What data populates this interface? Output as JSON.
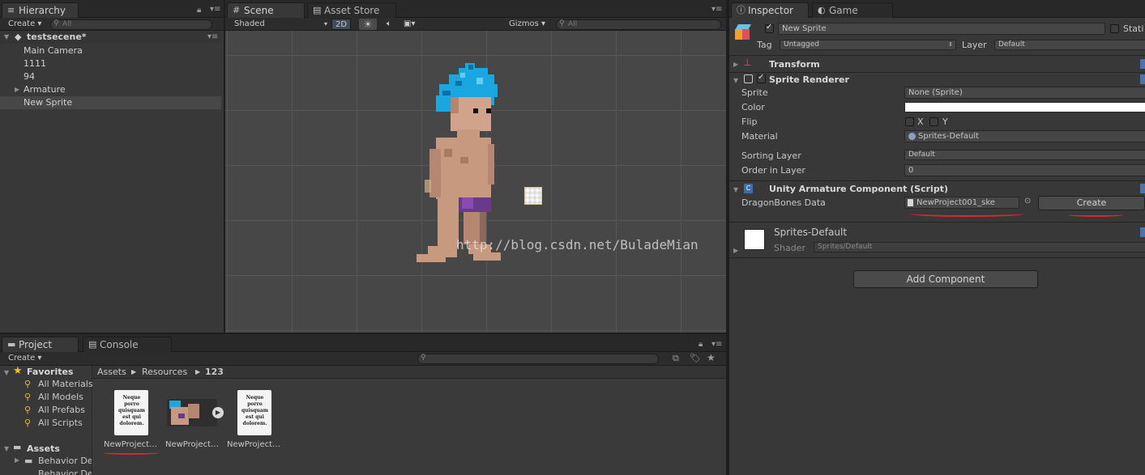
{
  "hierarchy": {
    "tab_label": "Hierarchy",
    "create_label": "Create ▾",
    "search_placeholder": "All",
    "scene_name": "testsecene*",
    "items": [
      "Main Camera",
      "1111",
      "94",
      "Armature",
      "New Sprite"
    ]
  },
  "scene": {
    "tab_scene": "Scene",
    "tab_asset_store": "Asset Store",
    "shading_mode": "Shaded",
    "mode_2d": "2D",
    "gizmos_label": "Gizmos ▾",
    "search_placeholder": "All",
    "watermark": "http://blog.csdn.net/BuladeMian"
  },
  "project": {
    "tab_project": "Project",
    "tab_console": "Console",
    "create_label": "Create ▾",
    "favorites_label": "Favorites",
    "favorites": [
      "All Materials",
      "All Models",
      "All Prefabs",
      "All Scripts"
    ],
    "assets_label": "Assets",
    "assets_children": [
      "Behavior De",
      "Behavior De"
    ],
    "breadcrumb": [
      "Assets",
      "Resources",
      "123"
    ],
    "files": [
      {
        "name": "NewProject…",
        "thumb_text": "Neque porro quisquam est qui dolorem."
      },
      {
        "name": "NewProject…",
        "thumb_text": ""
      },
      {
        "name": "NewProject…",
        "thumb_text": "Neque porro quisquam est qui dolorem."
      }
    ]
  },
  "inspector": {
    "tab_inspector": "Inspector",
    "tab_game": "Game",
    "object_name": "New Sprite",
    "static_label": "Stati",
    "tag_label": "Tag",
    "tag_value": "Untagged",
    "layer_label": "Layer",
    "layer_value": "Default",
    "transform_title": "Transform",
    "sprite_renderer": {
      "title": "Sprite Renderer",
      "sprite_label": "Sprite",
      "sprite_value": "None (Sprite)",
      "color_label": "Color",
      "color_value": "#ffffff",
      "flip_label": "Flip",
      "flip_x": "X",
      "flip_y": "Y",
      "material_label": "Material",
      "material_value": "Sprites-Default",
      "sorting_layer_label": "Sorting Layer",
      "sorting_layer_value": "Default",
      "order_label": "Order in Layer",
      "order_value": "0"
    },
    "armature": {
      "title": "Unity Armature Component (Script)",
      "data_label": "DragonBones Data",
      "data_value": "NewProject001_ske",
      "create_button": "Create"
    },
    "material_block": {
      "name": "Sprites-Default",
      "shader_label": "Shader",
      "shader_value": "Sprites/Default"
    },
    "add_component": "Add Component"
  },
  "colors": {
    "accent_red": "#e0282a",
    "hair_blue": "#1aa7e0",
    "skin": "#c79a80",
    "shorts": "#6a3a8a"
  }
}
